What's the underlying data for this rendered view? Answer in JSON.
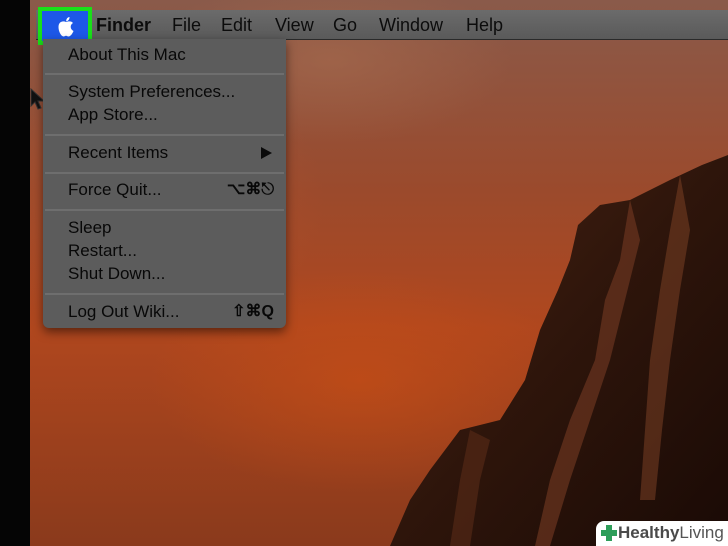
{
  "menubar": {
    "apple_icon": "apple-logo-icon",
    "items": [
      "Finder",
      "File",
      "Edit",
      "View",
      "Go",
      "Window",
      "Help"
    ]
  },
  "apple_menu": {
    "items": [
      {
        "label": "About This Mac"
      },
      {
        "label": "System Preferences..."
      },
      {
        "label": "App Store..."
      },
      {
        "label": "Recent Items",
        "submenu": true
      },
      {
        "label": "Force Quit...",
        "shortcut": "⌥⌘⎋"
      },
      {
        "label": "Sleep"
      },
      {
        "label": "Restart..."
      },
      {
        "label": "Shut Down..."
      },
      {
        "label": "Log Out Wiki...",
        "shortcut": "⇧⌘Q"
      }
    ]
  },
  "highlight_color": "#19e019",
  "selected_color": "#1d58e8",
  "watermark": {
    "brand_bold": "Healthy",
    "brand_light": "Living",
    "icon": "green-cross-icon"
  }
}
